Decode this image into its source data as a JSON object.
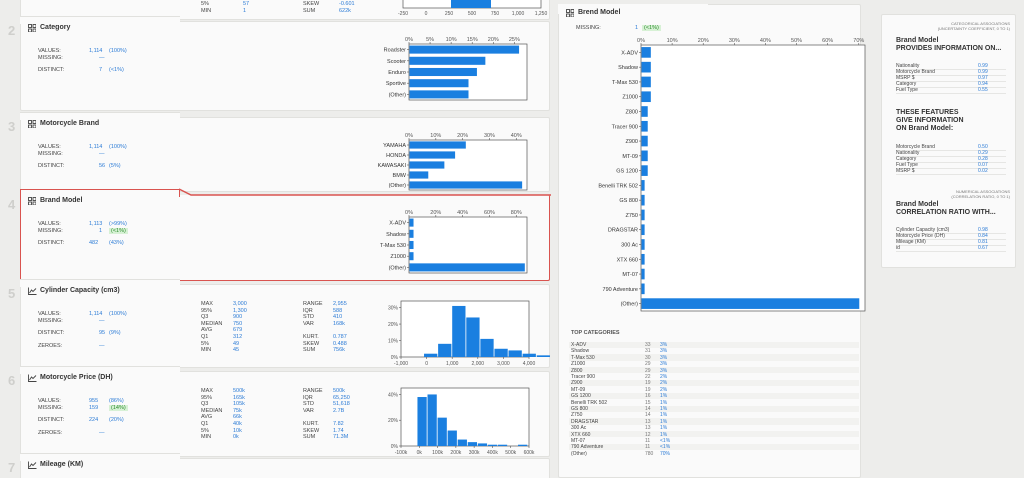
{
  "top_partial": {
    "rows": [
      {
        "label": "5%",
        "value": "57"
      },
      {
        "label": "MIN",
        "value": "1"
      }
    ],
    "rows2": [
      {
        "label": "SKEW",
        "value": "-0.601"
      },
      {
        "label": "SUM",
        "value": "622k"
      }
    ],
    "ticks": [
      "-250",
      "0",
      "250",
      "500",
      "750",
      "1,000",
      "1,250"
    ]
  },
  "variables": [
    {
      "num": "2",
      "name": "Category",
      "type": "categorical",
      "stats": [
        {
          "label": "VALUES:",
          "value": "1,114",
          "pct": "(100%)"
        },
        {
          "label": "MISSING:",
          "value": "—",
          "pct": ""
        },
        {
          "label": "DISTINCT:",
          "value": "7",
          "pct": "(<1%)"
        }
      ],
      "chart": {
        "xticks": [
          "0%",
          "5%",
          "10%",
          "15%",
          "20%",
          "25%"
        ],
        "xmax": 28,
        "bars": [
          {
            "label": "Roadster",
            "value": 26
          },
          {
            "label": "Scooter",
            "value": 18
          },
          {
            "label": "Enduro",
            "value": 16
          },
          {
            "label": "Sportive",
            "value": 14
          },
          {
            "label": "(Other)",
            "value": 14
          }
        ]
      }
    },
    {
      "num": "3",
      "name": "Motorcycle Brand",
      "type": "categorical",
      "stats": [
        {
          "label": "VALUES:",
          "value": "1,114",
          "pct": "(100%)"
        },
        {
          "label": "MISSING:",
          "value": "—",
          "pct": ""
        },
        {
          "label": "DISTINCT:",
          "value": "56",
          "pct": "(5%)"
        }
      ],
      "chart": {
        "xticks": [
          "0%",
          "10%",
          "20%",
          "30%",
          "40%"
        ],
        "xmax": 44,
        "bars": [
          {
            "label": "YAMAHA",
            "value": 21
          },
          {
            "label": "HONDA",
            "value": 17
          },
          {
            "label": "KAWASAKI",
            "value": 13
          },
          {
            "label": "BMW",
            "value": 7
          },
          {
            "label": "(Other)",
            "value": 42
          }
        ]
      }
    },
    {
      "num": "4",
      "name": "Brand Model",
      "type": "categorical",
      "selected": true,
      "stats": [
        {
          "label": "VALUES:",
          "value": "1,113",
          "pct": "(>99%)"
        },
        {
          "label": "MISSING:",
          "value": "1",
          "pct": "(<1%)",
          "green": true
        },
        {
          "label": "DISTINCT:",
          "value": "482",
          "pct": "(43%)"
        }
      ],
      "chart": {
        "xticks": [
          "0%",
          "20%",
          "40%",
          "60%",
          "80%"
        ],
        "xmax": 88,
        "bars": [
          {
            "label": "X-ADV",
            "value": 3
          },
          {
            "label": "Shadow",
            "value": 3
          },
          {
            "label": "T-Max 530",
            "value": 3
          },
          {
            "label": "Z1000",
            "value": 3
          },
          {
            "label": "(Other)",
            "value": 86
          }
        ]
      }
    },
    {
      "num": "5",
      "name": "Cylinder Capacity (cm3)",
      "type": "numerical",
      "stats": [
        {
          "label": "VALUES:",
          "value": "1,114",
          "pct": "(100%)"
        },
        {
          "label": "MISSING:",
          "value": "—",
          "pct": ""
        },
        {
          "label": "DISTINCT:",
          "value": "95",
          "pct": "(9%)"
        },
        {
          "label": "ZEROES:",
          "value": "—",
          "pct": ""
        }
      ],
      "quant": [
        {
          "label": "MAX",
          "value": "3,000"
        },
        {
          "label": "95%",
          "value": "1,300"
        },
        {
          "label": "Q3",
          "value": "900"
        },
        {
          "label": "MEDIAN",
          "value": "750"
        },
        {
          "label": "AVG",
          "value": "679"
        },
        {
          "label": "Q1",
          "value": "312"
        },
        {
          "label": "5%",
          "value": "49"
        },
        {
          "label": "MIN",
          "value": "45"
        }
      ],
      "moments": [
        {
          "label": "RANGE",
          "value": "2,955"
        },
        {
          "label": "IQR",
          "value": "588"
        },
        {
          "label": "STD",
          "value": "410"
        },
        {
          "label": "VAR",
          "value": "168k"
        },
        {
          "label": "",
          "value": ""
        },
        {
          "label": "KURT.",
          "value": "0.787"
        },
        {
          "label": "SKEW",
          "value": "0.488"
        },
        {
          "label": "SUM",
          "value": "756k"
        }
      ],
      "hist": {
        "yticks": [
          "30%",
          "20%",
          "10%",
          "0%"
        ],
        "ymax": 34,
        "xticks": [
          "-1,000",
          "0",
          "1,000",
          "2,000",
          "3,000",
          "4,000"
        ],
        "bins": [
          2,
          8,
          31,
          24,
          11,
          5,
          4,
          2,
          1,
          0,
          1
        ]
      }
    },
    {
      "num": "6",
      "name": "Motorcycle Price (DH)",
      "type": "numerical",
      "stats": [
        {
          "label": "VALUES:",
          "value": "955",
          "pct": "(86%)"
        },
        {
          "label": "MISSING:",
          "value": "159",
          "pct": "(14%)",
          "green": true
        },
        {
          "label": "DISTINCT:",
          "value": "224",
          "pct": "(20%)"
        },
        {
          "label": "ZEROES:",
          "value": "—",
          "pct": ""
        }
      ],
      "quant": [
        {
          "label": "MAX",
          "value": "500k"
        },
        {
          "label": "95%",
          "value": "165k"
        },
        {
          "label": "Q3",
          "value": "105k"
        },
        {
          "label": "MEDIAN",
          "value": "75k"
        },
        {
          "label": "AVG",
          "value": "66k"
        },
        {
          "label": "Q1",
          "value": "40k"
        },
        {
          "label": "5%",
          "value": "10k"
        },
        {
          "label": "MIN",
          "value": "0k"
        }
      ],
      "moments": [
        {
          "label": "RANGE",
          "value": "500k"
        },
        {
          "label": "IQR",
          "value": "65,250"
        },
        {
          "label": "STD",
          "value": "51,618"
        },
        {
          "label": "VAR",
          "value": "2.7B"
        },
        {
          "label": "",
          "value": ""
        },
        {
          "label": "KURT.",
          "value": "7.82"
        },
        {
          "label": "SKEW",
          "value": "1.74"
        },
        {
          "label": "SUM",
          "value": "71.3M"
        }
      ],
      "hist": {
        "yticks": [
          "40%",
          "20%",
          "0%"
        ],
        "ymax": 45,
        "xticks": [
          "-100k",
          "0k",
          "100k",
          "200k",
          "300k",
          "400k",
          "500k",
          "600k"
        ],
        "bins": [
          38,
          40,
          22,
          12,
          5,
          3,
          2,
          1,
          1,
          0,
          1
        ]
      }
    },
    {
      "num": "7",
      "name": "Mileage (KM)",
      "type": "numerical"
    }
  ],
  "detail": {
    "title": "Brend Model",
    "missing_label": "MISSING:",
    "missing_value": "1",
    "missing_pct": "(<1%)",
    "xticks": [
      "0%",
      "10%",
      "20%",
      "30%",
      "40%",
      "50%",
      "60%",
      "70%"
    ],
    "xmax": 72,
    "bars": [
      {
        "label": "X-ADV",
        "value": 3
      },
      {
        "label": "Shadow",
        "value": 3
      },
      {
        "label": "T-Max 530",
        "value": 3
      },
      {
        "label": "Z1000",
        "value": 3
      },
      {
        "label": "Z800",
        "value": 2
      },
      {
        "label": "Tracer 900",
        "value": 2
      },
      {
        "label": "Z900",
        "value": 2
      },
      {
        "label": "MT-09",
        "value": 2
      },
      {
        "label": "GS 1200",
        "value": 2
      },
      {
        "label": "Benelli TRK 502",
        "value": 1
      },
      {
        "label": "GS 800",
        "value": 1
      },
      {
        "label": "Z750",
        "value": 1
      },
      {
        "label": "DRAGSTAR",
        "value": 1
      },
      {
        "label": "300 Ac",
        "value": 1
      },
      {
        "label": "XTX 660",
        "value": 1
      },
      {
        "label": "MT-07",
        "value": 1
      },
      {
        "label": "790 Adventure",
        "value": 1
      },
      {
        "label": "(Other)",
        "value": 70
      }
    ],
    "top_title": "TOP CATEGORIES",
    "top": [
      {
        "name": "X-ADV",
        "count": "33",
        "pct": "3%"
      },
      {
        "name": "Shadow",
        "count": "31",
        "pct": "3%"
      },
      {
        "name": "T-Max 530",
        "count": "30",
        "pct": "3%"
      },
      {
        "name": "Z1000",
        "count": "29",
        "pct": "3%"
      },
      {
        "name": "Z800",
        "count": "29",
        "pct": "3%"
      },
      {
        "name": "Tracer 900",
        "count": "22",
        "pct": "2%"
      },
      {
        "name": "Z900",
        "count": "19",
        "pct": "2%"
      },
      {
        "name": "MT-09",
        "count": "19",
        "pct": "2%"
      },
      {
        "name": "GS 1200",
        "count": "16",
        "pct": "1%"
      },
      {
        "name": "Benelli TRK 502",
        "count": "15",
        "pct": "1%"
      },
      {
        "name": "GS 800",
        "count": "14",
        "pct": "1%"
      },
      {
        "name": "Z750",
        "count": "14",
        "pct": "1%"
      },
      {
        "name": "DRAGSTAR",
        "count": "13",
        "pct": "1%"
      },
      {
        "name": "300 Ac",
        "count": "13",
        "pct": "1%"
      },
      {
        "name": "XTX 660",
        "count": "12",
        "pct": "1%"
      },
      {
        "name": "MT-07",
        "count": "11",
        "pct": "<1%"
      },
      {
        "name": "790 Adventure",
        "count": "11",
        "pct": "<1%"
      },
      {
        "name": "(Other)",
        "count": "780",
        "pct": "70%"
      }
    ]
  },
  "assoc": {
    "cat_caption": "CATEGORICAL ASSOCIATIONS",
    "cat_caption2": "(UNCERTAINTY COEFFICIENT, 0 TO 1)",
    "h1a": "Brand Model",
    "h1b": "PROVIDES INFORMATION ON...",
    "list1": [
      {
        "name": "Nationality",
        "value": "0.99"
      },
      {
        "name": "Motorcycle Brand",
        "value": "0.99"
      },
      {
        "name": "MSRP $",
        "value": "0.97"
      },
      {
        "name": "Category",
        "value": "0.94"
      },
      {
        "name": "Fuel Type",
        "value": "0.55"
      }
    ],
    "h2a": "THESE FEATURES",
    "h2b": "GIVE INFORMATION",
    "h2c": "ON Brand Model:",
    "list2": [
      {
        "name": "Motorcycle Brand",
        "value": "0.50"
      },
      {
        "name": "Nationality",
        "value": "0.29"
      },
      {
        "name": "Category",
        "value": "0.28"
      },
      {
        "name": "Fuel Type",
        "value": "0.07"
      },
      {
        "name": "MSRP $",
        "value": "0.02"
      }
    ],
    "num_caption": "NUMERICAL ASSOCIATIONS",
    "num_caption2": "(CORRELATION RATIO, 0 TO 1)",
    "h3a": "Brand Model",
    "h3b": "CORRELATION RATIO WITH...",
    "list3": [
      {
        "name": "Cylinder Capacity (cm3)",
        "value": "0.98"
      },
      {
        "name": "Motorcycle Price (DH)",
        "value": "0.84"
      },
      {
        "name": "Mileage (KM)",
        "value": "0.81"
      },
      {
        "name": "id",
        "value": "0.67"
      }
    ]
  },
  "colors": {
    "bar": "#1a7fe0",
    "accent": "#2b7bd6",
    "selected_border": "#d9534f",
    "missing_bg": "#d7f1d5"
  }
}
